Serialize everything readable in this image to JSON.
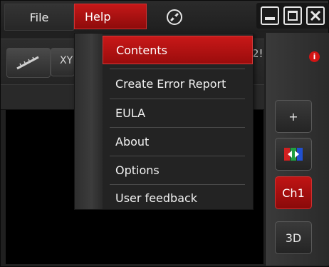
{
  "menubar": {
    "file_label": "File",
    "help_label": "Help"
  },
  "toolbar": {
    "xy_label": "XY",
    "clipped_value": "2!"
  },
  "help_menu": {
    "items": [
      {
        "label": "Contents",
        "active": true
      },
      {
        "label": "Create Error Report"
      },
      {
        "label": "EULA"
      },
      {
        "label": "About"
      },
      {
        "label": "Options"
      },
      {
        "label": "User feedback"
      }
    ]
  },
  "right_panel": {
    "alert_symbol": "i",
    "add_label": "+",
    "channel_label": "Ch1",
    "view_3d_label": "3D"
  },
  "icons": {
    "pin": "pin-icon",
    "minimize": "minimize-icon",
    "maximize": "maximize-icon",
    "close": "close-icon",
    "ruler": "ruler-icon",
    "channels": "channels-icon",
    "alert": "alert-icon"
  },
  "colors": {
    "accent": "#b51111",
    "background": "#202020",
    "text": "#f0f0f0"
  }
}
